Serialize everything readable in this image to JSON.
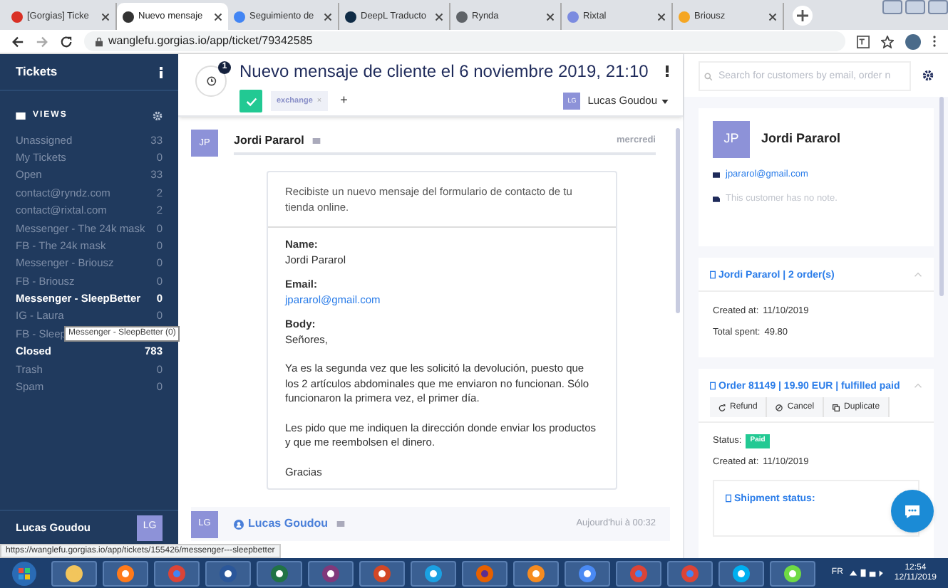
{
  "browser": {
    "tabs": [
      {
        "label": "[Gorgias] Ticke",
        "selected": false,
        "color": "#d93025"
      },
      {
        "label": "Nuevo mensaje",
        "selected": true,
        "color": "#333333"
      },
      {
        "label": "Seguimiento de",
        "selected": false,
        "color": "#4285f4"
      },
      {
        "label": "DeepL Traducto",
        "selected": false,
        "color": "#0f2b46"
      },
      {
        "label": "Rynda",
        "selected": false,
        "color": "#5f6368"
      },
      {
        "label": "Rixtal",
        "selected": false,
        "color": "#7b8be0"
      },
      {
        "label": "Briousz",
        "selected": false,
        "color": "#f5a623"
      }
    ],
    "url": "wanglefu.gorgias.io/app/ticket/79342585"
  },
  "sidebar": {
    "title": "Tickets",
    "views_label": "VIEWS",
    "items": [
      {
        "label": "Unassigned",
        "count": "33",
        "highlighted": false
      },
      {
        "label": "My Tickets",
        "count": "0",
        "highlighted": false
      },
      {
        "label": "Open",
        "count": "33",
        "highlighted": false
      },
      {
        "label": "contact@ryndz.com",
        "count": "2",
        "highlighted": false
      },
      {
        "label": "contact@rixtal.com",
        "count": "2",
        "highlighted": false
      },
      {
        "label": "Messenger - The 24k mask",
        "count": "0",
        "highlighted": false
      },
      {
        "label": "FB - The 24k mask",
        "count": "0",
        "highlighted": false
      },
      {
        "label": "Messenger - Briousz",
        "count": "0",
        "highlighted": false
      },
      {
        "label": "FB - Briousz",
        "count": "0",
        "highlighted": false
      },
      {
        "label": "Messenger - SleepBetter",
        "count": "0",
        "highlighted": true
      },
      {
        "label": "IG - Laura",
        "count": "0",
        "highlighted": false
      },
      {
        "label": "FB - Sleep",
        "highlighted": false
      },
      {
        "label": "Closed",
        "count": "783",
        "highlighted": true
      },
      {
        "label": "Trash",
        "count": "0",
        "highlighted": false
      },
      {
        "label": "Spam",
        "count": "0",
        "highlighted": false
      }
    ],
    "tooltip": "Messenger - SleepBetter (0)",
    "user": {
      "name": "Lucas Goudou",
      "initials": "LG"
    }
  },
  "ticket": {
    "title": "Nuevo mensaje de cliente el 6 noviembre 2019, 21:10",
    "history_count": "1",
    "tag": "exchange",
    "tag_remove": "×",
    "add_tag": "+",
    "assignee": {
      "initials": "LG",
      "name": "Lucas Goudou"
    },
    "messages": [
      {
        "initials": "JP",
        "author": "Jordi Pararol",
        "time": "mercredi",
        "intro": "Recibiste un nuevo mensaje del formulario de contacto de tu tienda online.",
        "fields": [
          {
            "label": "Name:",
            "lines": [
              "Jordi Pararol"
            ],
            "kind": "text"
          },
          {
            "label": "Email:",
            "lines": [
              "jpararol@gmail.com"
            ],
            "kind": "link"
          },
          {
            "label": "Body:",
            "lines": [
              "Señores,",
              "Ya es la segunda vez que les solicitó la devolución, puesto que los 2 artículos abdominales que me enviaron no funcionan. Sólo funcionaron la primera vez, el primer día.",
              "Les pido que me indiquen la dirección donde enviar los productos y que me reembolsen el dinero.",
              "Gracias"
            ],
            "kind": "text"
          }
        ]
      },
      {
        "initials": "LG",
        "author": "Lucas Goudou",
        "time": "Aujourd'hui à 00:32"
      }
    ]
  },
  "customer": {
    "search_placeholder": "Search for customers by email, order n",
    "initials": "JP",
    "name": "Jordi Pararol",
    "email": "jpararol@gmail.com",
    "note": "This customer has no note.",
    "orders_card": {
      "title": "Jordi Pararol | 2 order(s)",
      "rows": [
        {
          "label": "Created at:",
          "value": "11/10/2019"
        },
        {
          "label": "Total spent:",
          "value": "49.80"
        }
      ]
    },
    "order_card": {
      "title": "Order 81149 | 19.90 EUR | fulfilled paid",
      "actions": [
        "Refund",
        "Cancel",
        "Duplicate"
      ],
      "status_label": "Status:",
      "status": "Paid",
      "created_label": "Created at:",
      "created": "11/10/2019",
      "shipment": "Shipment status:"
    }
  },
  "status_url": "https://wanglefu.gorgias.io/app/tickets/155426/messenger---sleepbetter",
  "taskbar": {
    "language": "FR",
    "time": "12:54",
    "date": "12/11/2019"
  }
}
